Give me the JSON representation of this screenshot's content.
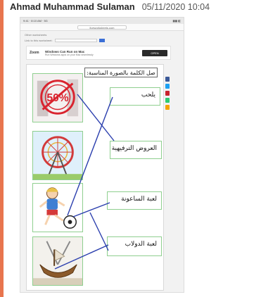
{
  "message": {
    "sender": "Ahmad Muhammad Sulaman",
    "timestamp": "05/11/2020 10:04"
  },
  "screenshot": {
    "statusbar": {
      "left": "9:41 ⋅ 8:10 AM ⋅ 5G",
      "right": "▮▮▮ ◧"
    },
    "url": "liveworksheets.com",
    "line_a": "Other worksheets",
    "line_b": "Link to this worksheet:",
    "ad": {
      "logo": "Zoom",
      "title": "Windows Can Run on Mac",
      "subtitle": "Run Windows apps on your Mac seamlessly",
      "button": "OPEN"
    },
    "worksheet": {
      "title": "صل الكلمة بالصورة المناسبة:",
      "words": [
        {
          "id": "w1",
          "text": "يلحب"
        },
        {
          "id": "w2",
          "text": "العروض الترفيهية"
        },
        {
          "id": "w3",
          "text": "لعبة الساعونة"
        },
        {
          "id": "w4",
          "text": "لعبة الدولاب"
        }
      ],
      "pictures": [
        {
          "icon": "sale-stamp-icon"
        },
        {
          "icon": "ferris-wheel-icon"
        },
        {
          "icon": "boy-football-icon"
        },
        {
          "icon": "pirate-ship-ride-icon"
        }
      ],
      "stamp_text": "50%"
    },
    "share_colors": [
      "#3b5998",
      "#1da1f2",
      "#c8232c",
      "#2ecc71",
      "#f4a300"
    ]
  }
}
